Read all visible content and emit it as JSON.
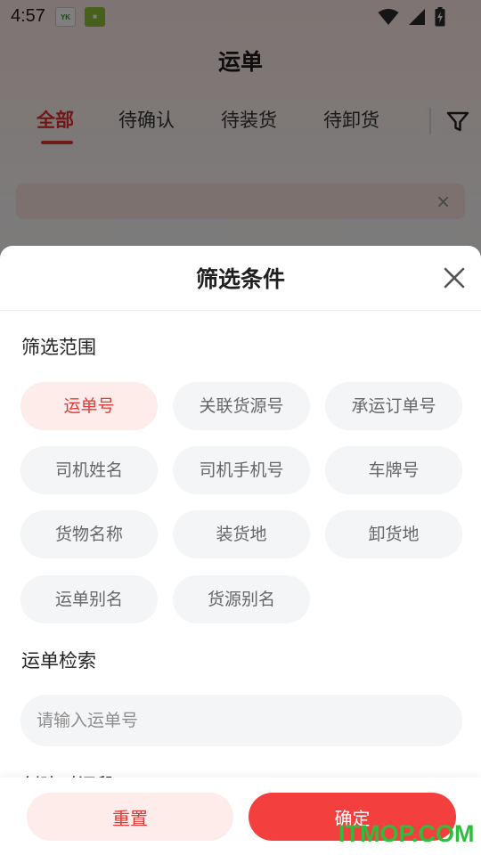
{
  "status_bar": {
    "time": "4:57",
    "notification_icons": [
      "yk-app-icon",
      "green-app-icon"
    ],
    "system_icons": [
      "wifi-icon",
      "cell-signal-icon",
      "battery-charging-icon"
    ]
  },
  "page": {
    "title": "运单",
    "tabs": [
      {
        "label": "全部",
        "active": true
      },
      {
        "label": "待确认",
        "active": false
      },
      {
        "label": "待装货",
        "active": false
      },
      {
        "label": "待卸货",
        "active": false
      }
    ],
    "filter_icon": "funnel-icon",
    "notice_close": "×"
  },
  "sheet": {
    "title": "筛选条件",
    "close_icon": "close-icon",
    "scope_label": "筛选范围",
    "scope_options": [
      {
        "label": "运单号",
        "selected": true
      },
      {
        "label": "关联货源号",
        "selected": false
      },
      {
        "label": "承运订单号",
        "selected": false
      },
      {
        "label": "司机姓名",
        "selected": false
      },
      {
        "label": "司机手机号",
        "selected": false
      },
      {
        "label": "车牌号",
        "selected": false
      },
      {
        "label": "货物名称",
        "selected": false
      },
      {
        "label": "装货地",
        "selected": false
      },
      {
        "label": "卸货地",
        "selected": false
      },
      {
        "label": "运单别名",
        "selected": false
      },
      {
        "label": "货源别名",
        "selected": false
      }
    ],
    "search_label": "运单检索",
    "search_placeholder": "请输入运单号",
    "search_value": "",
    "next_section_label": "创建时间段",
    "reset_label": "重置",
    "confirm_label": "确定"
  },
  "colors": {
    "accent": "#e53935",
    "confirm_button": "#f43f3f",
    "chip_selected_bg": "#fdecea",
    "chip_bg": "#f4f5f7"
  },
  "watermark": "ITMOP.COM"
}
